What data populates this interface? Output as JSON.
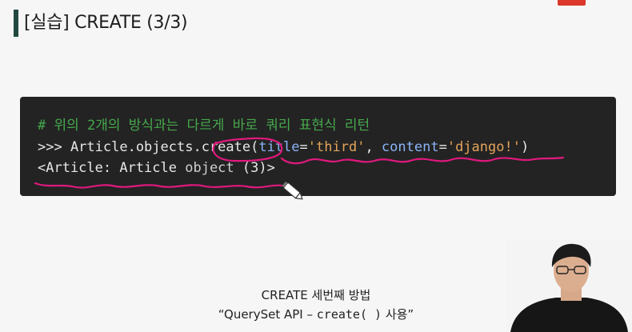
{
  "slide": {
    "title": "[실습] CREATE (3/3)"
  },
  "code": {
    "line1": "# 위의 2개의 방식과는 다르게 바로 쿼리 표현식 리턴",
    "line2": {
      "prompt": ">>> Article.objects.create(",
      "kw1": "title",
      "eq1": "=",
      "str1": "'third'",
      "sep": ", ",
      "kw2": "content",
      "eq2": "=",
      "str2": "'django!'",
      "end": ")"
    },
    "line3": {
      "prefix": "<Article: Article ",
      "obj": "object",
      "suffix": " (3)>"
    }
  },
  "caption": {
    "line1": "CREATE 세번째 방법",
    "line2_prefix": "“QuerySet API – ",
    "line2_code": "create( )",
    "line2_suffix": " 사용”"
  },
  "annotation_color": "#e0197d",
  "accent_bar_color": "#22483f"
}
